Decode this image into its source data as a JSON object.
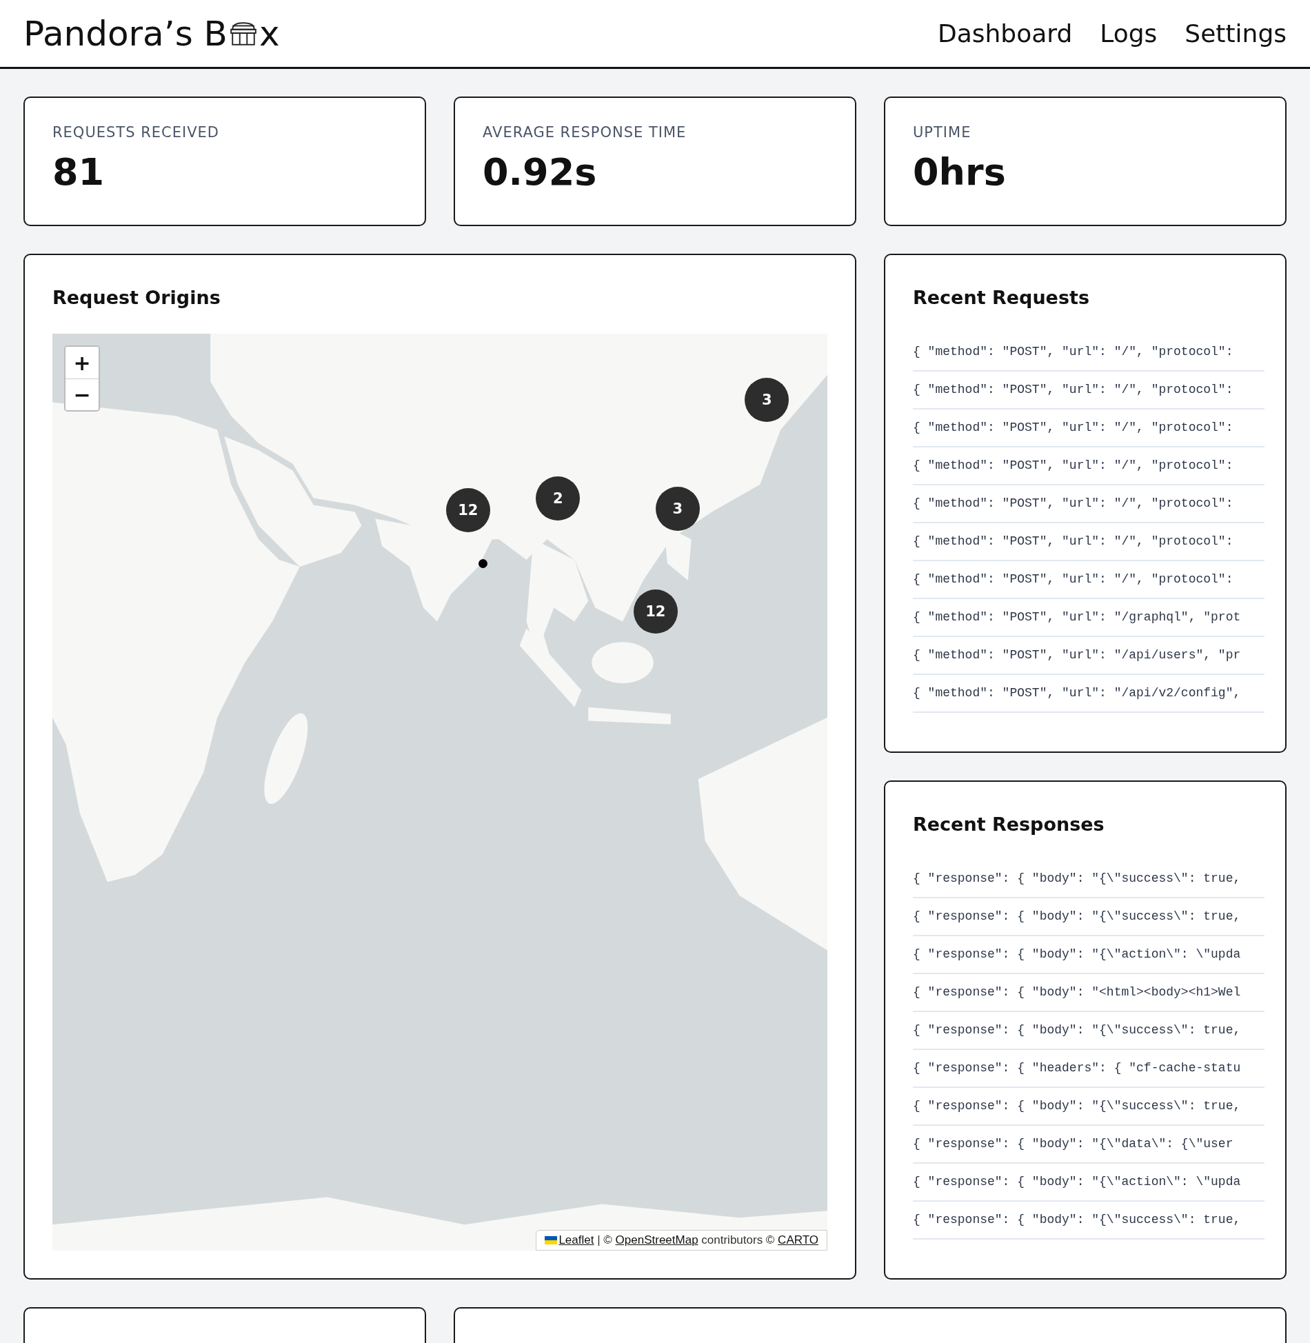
{
  "header": {
    "logo_before": "Pandora’s B",
    "logo_after": "x",
    "nav": [
      "Dashboard",
      "Logs",
      "Settings"
    ]
  },
  "stats": [
    {
      "label": "REQUESTS RECEIVED",
      "value": "81"
    },
    {
      "label": "AVERAGE RESPONSE TIME",
      "value": "0.92s"
    },
    {
      "label": "UPTIME",
      "value": "0hrs"
    }
  ],
  "map_panel": {
    "title": "Request Origins",
    "zoom_controls": [
      "+",
      "−"
    ],
    "markers": [
      {
        "kind": "cluster",
        "count": "12"
      },
      {
        "kind": "cluster",
        "count": "2"
      },
      {
        "kind": "cluster",
        "count": "3"
      },
      {
        "kind": "cluster",
        "count": "3"
      },
      {
        "kind": "cluster",
        "count": "12"
      },
      {
        "kind": "point"
      }
    ],
    "attribution": [
      {
        "kind": "link",
        "text": "Leaflet"
      },
      {
        "kind": "text",
        "text": " | © "
      },
      {
        "kind": "link",
        "text": "OpenStreetMap"
      },
      {
        "kind": "text",
        "text": " contributors © "
      },
      {
        "kind": "link",
        "text": "CARTO"
      }
    ]
  },
  "recent_requests": {
    "title": "Recent Requests",
    "items": [
      "{ \"method\": \"POST\", \"url\": \"/\", \"protocol\":",
      "{ \"method\": \"POST\", \"url\": \"/\", \"protocol\":",
      "{ \"method\": \"POST\", \"url\": \"/\", \"protocol\":",
      "{ \"method\": \"POST\", \"url\": \"/\", \"protocol\":",
      "{ \"method\": \"POST\", \"url\": \"/\", \"protocol\":",
      "{ \"method\": \"POST\", \"url\": \"/\", \"protocol\":",
      "{ \"method\": \"POST\", \"url\": \"/\", \"protocol\":",
      "{ \"method\": \"POST\", \"url\": \"/graphql\", \"prot",
      "{ \"method\": \"POST\", \"url\": \"/api/users\", \"pr",
      "{ \"method\": \"POST\", \"url\": \"/api/v2/config\","
    ]
  },
  "recent_responses": {
    "title": "Recent Responses",
    "items": [
      "{ \"response\": { \"body\": \"{\\\"success\\\": true,",
      "{ \"response\": { \"body\": \"{\\\"success\\\": true,",
      "{ \"response\": { \"body\": \"{\\\"action\\\": \\\"upda",
      "{ \"response\": { \"body\": \"<html><body><h1>Wel",
      "{ \"response\": { \"body\": \"{\\\"success\\\": true,",
      "{ \"response\": { \"headers\": { \"cf-cache-statu",
      "{ \"response\": { \"body\": \"{\\\"success\\\": true,",
      "{ \"response\": { \"body\": \"{\\\"data\\\": {\\\"user",
      "{ \"response\": { \"body\": \"{\\\"action\\\": \\\"upda",
      "{ \"response\": { \"body\": \"{\\\"success\\\": true,"
    ]
  }
}
